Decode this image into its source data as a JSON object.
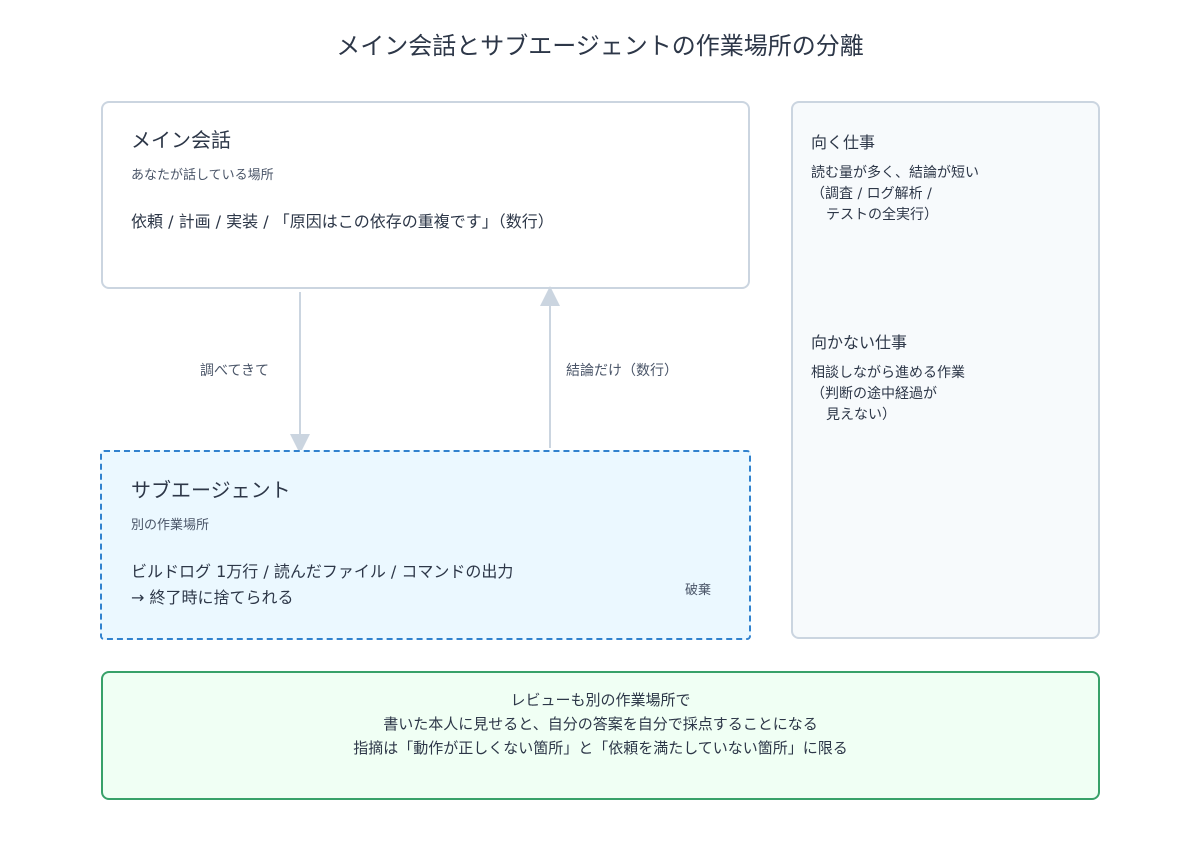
{
  "title": "メイン会話とサブエージェントの作業場所の分離",
  "main": {
    "heading": "メイン会話",
    "subheading": "あなたが話している場所",
    "content": "依頼 / 計画 / 実装 / 「原因はこの依存の重複です」（数行）"
  },
  "sub": {
    "heading": "サブエージェント",
    "subheading": "別の作業場所",
    "line1": "ビルドログ 1万行 / 読んだファイル / コマンドの出力",
    "line2": "→ 終了時に捨てられる",
    "discard_label": "破棄"
  },
  "arrows": {
    "down_label": "調べてきて",
    "up_label": "結論だけ（数行）"
  },
  "side": {
    "good_heading": "向く仕事",
    "good_lines": [
      "読む量が多く、結論が短い",
      "（調査 / ログ解析 /",
      "テストの全実行）"
    ],
    "bad_heading": "向かない仕事",
    "bad_lines": [
      "相談しながら進める作業",
      "（判断の途中経過が",
      "見えない）"
    ]
  },
  "review": {
    "line1": "レビューも別の作業場所で",
    "line2": "書いた本人に見せると、自分の答案を自分で採点することになる",
    "line3": "指摘は「動作が正しくない箇所」と「依頼を満たしていない箇所」に限る"
  },
  "colors": {
    "main_border": "#cbd5e0",
    "sub_border": "#3182ce",
    "sub_fill": "#ebf8ff",
    "review_border": "#38a169",
    "review_fill": "#f0fff4",
    "arrow": "#cbd5e0"
  }
}
